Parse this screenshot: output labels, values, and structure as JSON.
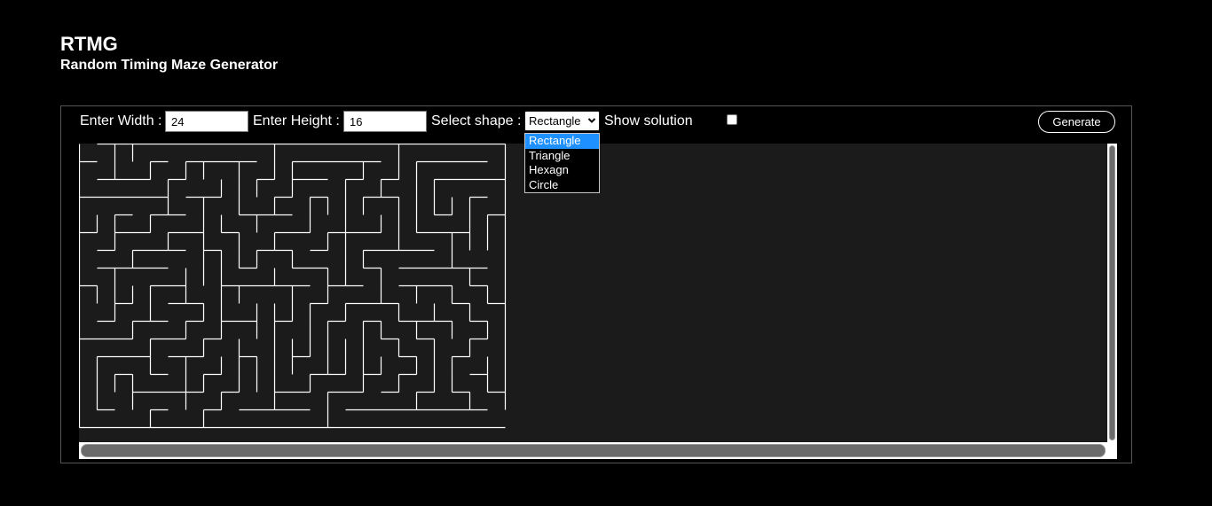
{
  "header": {
    "title": "RTMG",
    "subtitle": "Random Timing Maze Generator"
  },
  "controls": {
    "width_label": "Enter Width :",
    "width_value": "24",
    "height_label": "Enter Height :",
    "height_value": "16",
    "shape_label": "Select shape :",
    "shape_selected": "Rectangle",
    "shape_options": [
      "Rectangle",
      "Triangle",
      "Hexagn",
      "Circle"
    ],
    "show_solution_label": "Show solution",
    "show_solution_checked": false,
    "generate_label": "Generate"
  },
  "maze": {
    "cols": 24,
    "rows": 16,
    "seed": 7,
    "wall_color": "#ffffff",
    "background_color": "#1b1b1b"
  },
  "colors": {
    "page_background": "#000000",
    "selected_option": "#1e90ff"
  }
}
